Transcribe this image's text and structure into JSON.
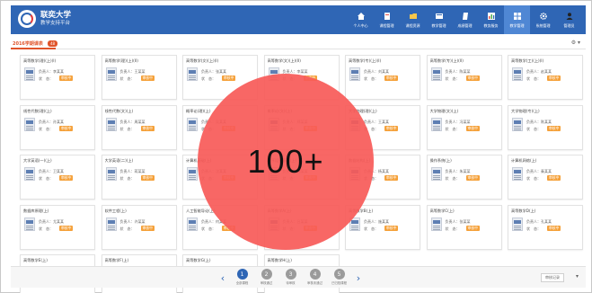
{
  "header": {
    "title": "联奕大学",
    "subtitle": "教学支持平台",
    "nav": [
      {
        "label": "个人中心",
        "icon": "home-icon"
      },
      {
        "label": "课程管理",
        "icon": "book-icon"
      },
      {
        "label": "课程资源",
        "icon": "folder-icon"
      },
      {
        "label": "教学管理",
        "icon": "board-icon"
      },
      {
        "label": "成绩管理",
        "icon": "document-icon"
      },
      {
        "label": "教务服务",
        "icon": "chart-icon"
      },
      {
        "label": "教学管理",
        "icon": "windows-icon",
        "active": true
      },
      {
        "label": "系统管理",
        "icon": "gear-icon"
      },
      {
        "label": "管理员",
        "icon": "user-icon"
      }
    ]
  },
  "toolbar": {
    "tab_label": "2016学期课表",
    "tab_count": "48",
    "settings": "⚙ ▾"
  },
  "cards": [
    {
      "title": "高等数学(理)(上)(I)",
      "author": "负责人：李某某",
      "status_label": "状　态：",
      "status": "审核中"
    },
    {
      "title": "高等数学(理)(上)(II)",
      "author": "负责人：王某某",
      "status_label": "状　态：",
      "status": "审核中"
    },
    {
      "title": "高等数学(文)(上)(I)",
      "author": "负责人：张某某",
      "status_label": "状　态：",
      "status": "审核中"
    },
    {
      "title": "高等数学(文)(上)(II)",
      "author": "负责人：李某某",
      "status_label": "状　态：",
      "status": "审核中"
    },
    {
      "title": "高等数学(专)(上)(I)",
      "author": "负责人：刘某某",
      "status_label": "状　态：",
      "status": "审核中"
    },
    {
      "title": "高等数学(专)(上)(II)",
      "author": "负责人：陈某某",
      "status_label": "状　态：",
      "status": "审核中"
    },
    {
      "title": "高等数学(工)(上)(I)",
      "author": "负责人：赵某某",
      "status_label": "状　态：",
      "status": "审核中"
    },
    {
      "title": "线性代数(理)(上)",
      "author": "负责人：孙某某",
      "status_label": "状　态：",
      "status": "审核中"
    },
    {
      "title": "线性代数(文)(上)",
      "author": "负责人：周某某",
      "status_label": "状　态：",
      "status": "审核中"
    },
    {
      "title": "概率论(理)(上)",
      "author": "负责人：吴某某",
      "status_label": "状　态：",
      "status": "审核中"
    },
    {
      "title": "概率论(文)(上)",
      "author": "负责人：郑某某",
      "status_label": "状　态：",
      "status": "审核中"
    },
    {
      "title": "大学物理(理)(上)",
      "author": "负责人：王某某",
      "status_label": "状　态：",
      "status": "审核中"
    },
    {
      "title": "大学物理(文)(上)",
      "author": "负责人：冯某某",
      "status_label": "状　态：",
      "status": "审核中"
    },
    {
      "title": "大学物理(专)(上)",
      "author": "负责人：陈某某",
      "status_label": "状　态：",
      "status": "审核中"
    },
    {
      "title": "大学英语(一)(上)",
      "author": "负责人：卫某某",
      "status_label": "状　态：",
      "status": "审核中"
    },
    {
      "title": "大学英语(二)(上)",
      "author": "负责人：蒋某某",
      "status_label": "状　态：",
      "status": "审核中"
    },
    {
      "title": "计算机基础(上)",
      "author": "负责人：沈某某",
      "status_label": "状　态：",
      "status": "审核中"
    },
    {
      "title": "程序设计基础(上)",
      "author": "负责人：韩某某",
      "status_label": "状　态：",
      "status": "审核中"
    },
    {
      "title": "数据结构(上)",
      "author": "负责人：杨某某",
      "status_label": "状　态：",
      "status": "审核中"
    },
    {
      "title": "操作系统(上)",
      "author": "负责人：朱某某",
      "status_label": "状　态：",
      "status": "审核中"
    },
    {
      "title": "计算机网络(上)",
      "author": "负责人：秦某某",
      "status_label": "状　态：",
      "status": "审核中"
    },
    {
      "title": "数据库原理(上)",
      "author": "负责人：尤某某",
      "status_label": "状　态：",
      "status": "审核中"
    },
    {
      "title": "软件工程(上)",
      "author": "负责人：许某某",
      "status_label": "状　态：",
      "status": "审核中"
    },
    {
      "title": "人工智能导论(上)",
      "author": "负责人：何某某",
      "status_label": "状　态：",
      "status": "审核中"
    },
    {
      "title": "高等数学A(上)",
      "author": "负责人：吕某某",
      "status_label": "状　态：",
      "status": "审核中"
    },
    {
      "title": "高等数学B(上)",
      "author": "负责人：施某某",
      "status_label": "状　态：",
      "status": "审核中"
    },
    {
      "title": "高等数学C(上)",
      "author": "负责人：张某某",
      "status_label": "状　态：",
      "status": "审核中"
    },
    {
      "title": "高等数学D(上)",
      "author": "负责人：孔某某",
      "status_label": "状　态：",
      "status": "审核中"
    },
    {
      "title": "高等数学E(上)",
      "author": "负责人：曹某某",
      "status_label": "状　态：",
      "status": "审核中"
    },
    {
      "title": "高等数学F(上)",
      "author": "负责人：严某某",
      "status_label": "状　态：",
      "status": "审核中"
    },
    {
      "title": "高等数学G(上)",
      "author": "负责人：华某某",
      "status_label": "状　态：",
      "status": "审核中"
    },
    {
      "title": "高等数学H(上)",
      "author": "负责人：金某某",
      "status_label": "状　态：",
      "status": "审核中"
    }
  ],
  "overlay": {
    "text": "100+"
  },
  "pager": {
    "prev": "‹",
    "next": "›",
    "pages": [
      {
        "num": "1",
        "label": "全部课程",
        "active": true
      },
      {
        "num": "2",
        "label": "审核通过"
      },
      {
        "num": "3",
        "label": "待审核"
      },
      {
        "num": "4",
        "label": "审核未通过"
      },
      {
        "num": "5",
        "label": "已归档课程"
      }
    ]
  },
  "footer": {
    "filter": "审核记录",
    "chevron": "▾"
  },
  "colors": {
    "header_bg": "#2f66b5",
    "accent": "#e0542a",
    "status": "#f5a13a",
    "overlay": "#f75a58"
  }
}
